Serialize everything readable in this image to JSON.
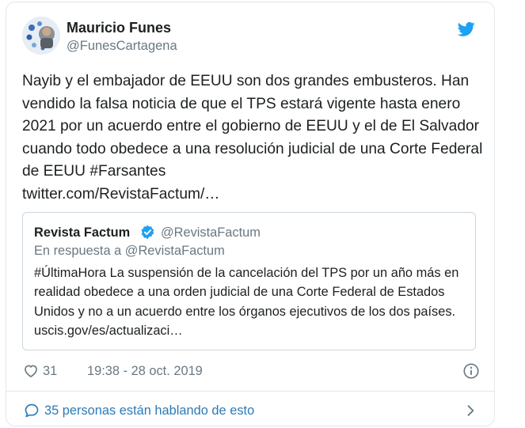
{
  "author": {
    "name": "Mauricio Funes",
    "handle": "@FunesCartagena"
  },
  "tweet": {
    "text": "Nayib y el embajador de EEUU son dos grandes embusteros. Han vendido la falsa noticia de que el TPS estará vigente hasta enero 2021 por un acuerdo entre el gobierno de EEUU y el de El Salvador cuando todo obedece a una resolución judicial de una Corte Federal de EEUU #Farsantes",
    "link": "twitter.com/RevistaFactum/…"
  },
  "quoted": {
    "name": "Revista Factum",
    "handle": "@RevistaFactum",
    "reply_to": "En respuesta a @RevistaFactum",
    "text": "#ÚltimaHora La suspensión de la cancelación del TPS por un año más en realidad obedece a una orden judicial de una Corte Federal de Estados Unidos y no a un acuerdo entre los órganos ejecutivos de los dos países. uscis.gov/es/actualizaci…"
  },
  "stats": {
    "likes": "31",
    "timestamp": "19:38 - 28 oct. 2019"
  },
  "footer": {
    "conversation": "35 personas están hablando de esto"
  },
  "colors": {
    "link_blue": "#2b7bb9",
    "twitter_blue": "#1da1f2",
    "muted": "#697882",
    "border": "#e1e8ed"
  },
  "icons": [
    "twitter-bird-icon",
    "verified-badge-icon",
    "heart-icon",
    "info-icon",
    "speech-bubble-icon",
    "chevron-right-icon"
  ]
}
